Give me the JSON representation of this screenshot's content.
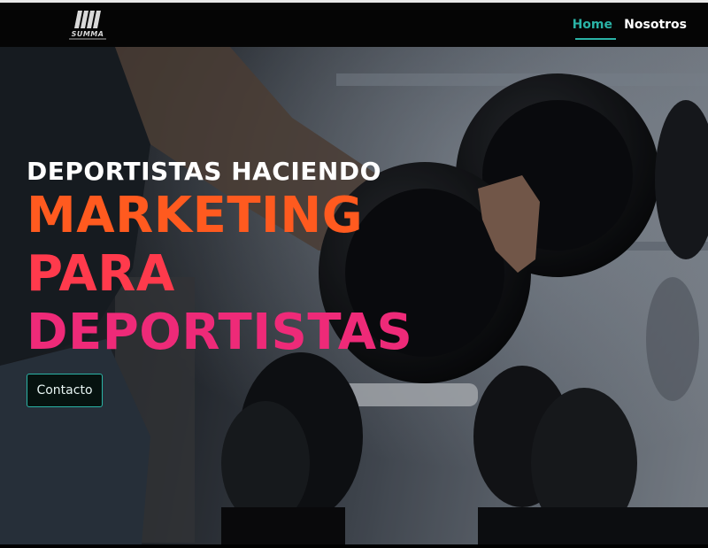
{
  "brand": {
    "name": "SUMMA",
    "logo_icon": "summa-bars-logo"
  },
  "nav": {
    "items": [
      {
        "label": "Home",
        "active": true
      },
      {
        "label": "Nosotros",
        "active": false
      }
    ]
  },
  "hero": {
    "kicker": "DEPORTISTAS HACIENDO",
    "headline": [
      "MARKETING",
      "PARA",
      "DEPORTISTAS"
    ],
    "cta_label": "Contacto",
    "background_image": "gym-dumbbells-photo"
  },
  "colors": {
    "accent": "#2ab3a6",
    "headline_orange": "#ff5a1f",
    "headline_red": "#ff3a4c",
    "headline_pink": "#ee2a78"
  }
}
